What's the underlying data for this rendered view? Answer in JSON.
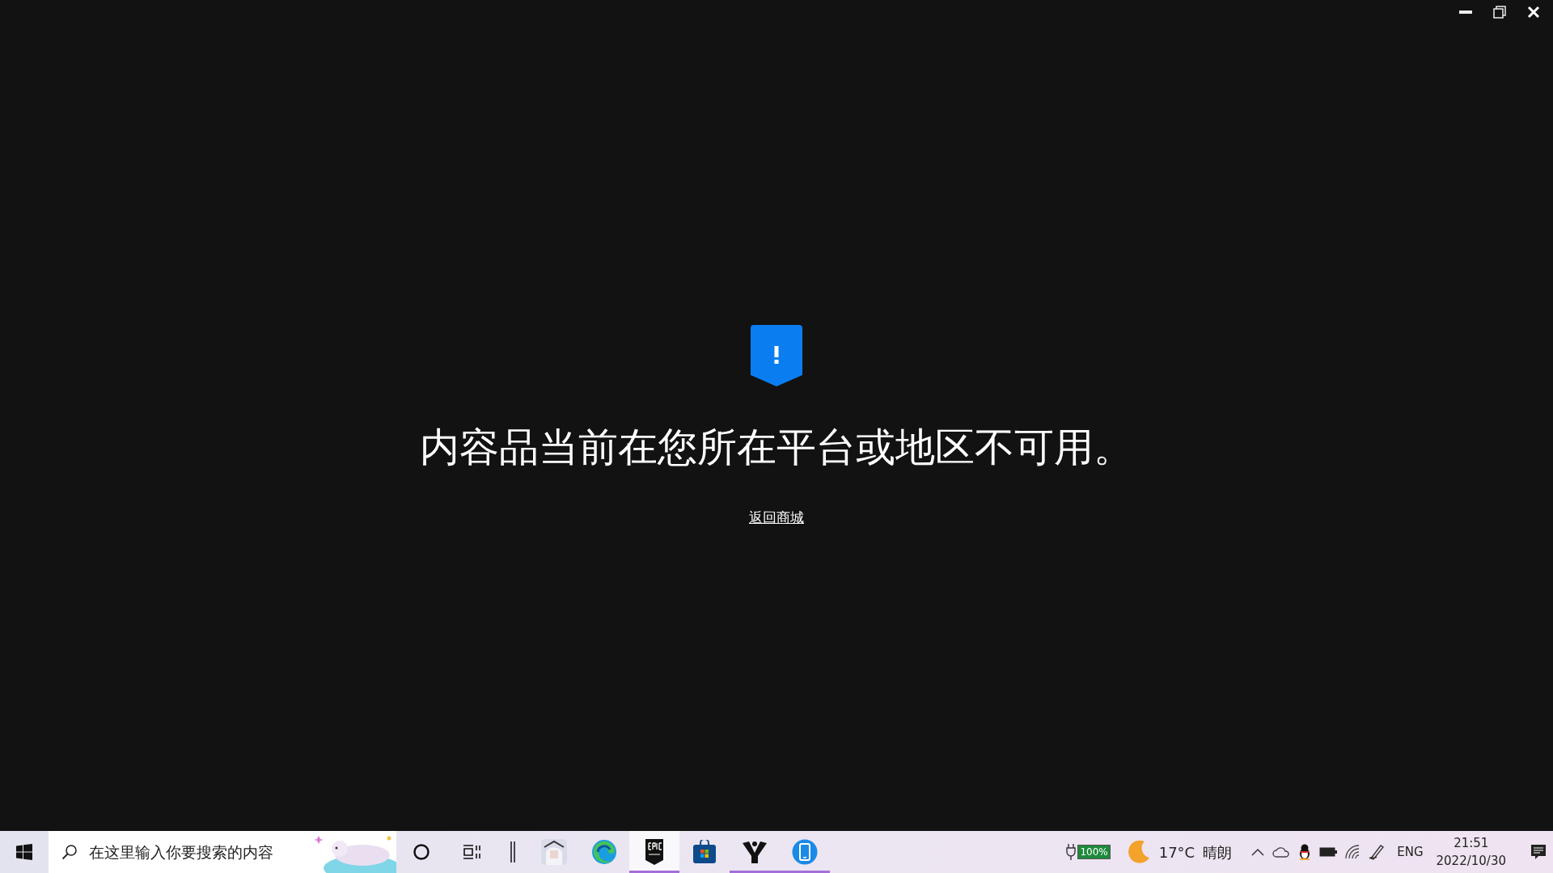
{
  "message": {
    "title": "内容品当前在您所在平台或地区不可用。",
    "link": "返回商城"
  },
  "taskbar": {
    "search": {
      "placeholder": "在这里输入你要搜索的内容"
    },
    "apps": [
      {
        "kind": "cortana",
        "running": false,
        "selected": false
      },
      {
        "kind": "taskview",
        "running": false,
        "selected": false
      },
      {
        "kind": "bars",
        "running": false,
        "selected": false
      },
      {
        "kind": "game",
        "running": false,
        "selected": false
      },
      {
        "kind": "edge",
        "running": false,
        "selected": false
      },
      {
        "kind": "epic",
        "running": true,
        "selected": true
      },
      {
        "kind": "store",
        "running": false,
        "selected": false
      },
      {
        "kind": "destiny",
        "running": true,
        "selected": false
      },
      {
        "kind": "phone",
        "running": true,
        "selected": false
      }
    ],
    "battery": "100%",
    "temperature": "17°C",
    "weather": "晴朗",
    "language": "ENG",
    "time": "21:51",
    "date": "2022/10/30"
  }
}
